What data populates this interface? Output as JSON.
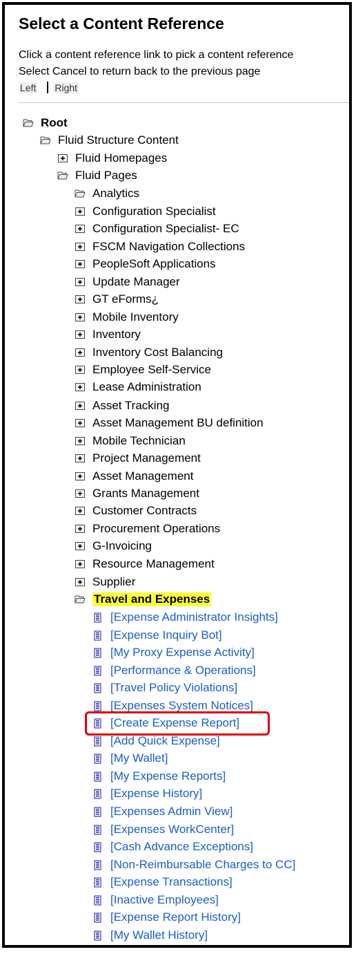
{
  "page": {
    "title": "Select a Content Reference",
    "instruction_1": "Click a content reference link to pick a content reference",
    "instruction_2": "Select Cancel to return back to the previous page",
    "left_label": "Left",
    "right_label": "Right"
  },
  "tree": [
    {
      "label": "Root",
      "level": 0,
      "icon": "folder-open-icon",
      "style": "bold"
    },
    {
      "label": "Fluid Structure Content",
      "level": 1,
      "icon": "folder-open-icon"
    },
    {
      "label": "Fluid Homepages",
      "level": 2,
      "icon": "folder-expand-icon"
    },
    {
      "label": "Fluid Pages",
      "level": 2,
      "icon": "folder-open-icon"
    },
    {
      "label": "Analytics",
      "level": 3,
      "icon": "folder-open-icon"
    },
    {
      "label": "Configuration Specialist",
      "level": 3,
      "icon": "folder-expand-icon"
    },
    {
      "label": "Configuration Specialist- EC",
      "level": 3,
      "icon": "folder-expand-icon"
    },
    {
      "label": "FSCM Navigation Collections",
      "level": 3,
      "icon": "folder-expand-icon"
    },
    {
      "label": "PeopleSoft Applications",
      "level": 3,
      "icon": "folder-expand-icon"
    },
    {
      "label": "Update Manager",
      "level": 3,
      "icon": "folder-expand-icon"
    },
    {
      "label": "GT eForms¿",
      "level": 3,
      "icon": "folder-expand-icon"
    },
    {
      "label": "Mobile Inventory",
      "level": 3,
      "icon": "folder-expand-icon"
    },
    {
      "label": "Inventory",
      "level": 3,
      "icon": "folder-expand-icon"
    },
    {
      "label": "Inventory Cost Balancing",
      "level": 3,
      "icon": "folder-expand-icon"
    },
    {
      "label": "Employee Self-Service",
      "level": 3,
      "icon": "folder-expand-icon"
    },
    {
      "label": "Lease Administration",
      "level": 3,
      "icon": "folder-expand-icon"
    },
    {
      "label": "Asset Tracking",
      "level": 3,
      "icon": "folder-expand-icon"
    },
    {
      "label": "Asset Management BU definition",
      "level": 3,
      "icon": "folder-expand-icon"
    },
    {
      "label": "Mobile Technician",
      "level": 3,
      "icon": "folder-expand-icon"
    },
    {
      "label": "Project Management",
      "level": 3,
      "icon": "folder-expand-icon"
    },
    {
      "label": "Asset Management",
      "level": 3,
      "icon": "folder-expand-icon"
    },
    {
      "label": "Grants Management",
      "level": 3,
      "icon": "folder-expand-icon"
    },
    {
      "label": "Customer Contracts",
      "level": 3,
      "icon": "folder-expand-icon"
    },
    {
      "label": "Procurement Operations",
      "level": 3,
      "icon": "folder-expand-icon"
    },
    {
      "label": "G-Invoicing",
      "level": 3,
      "icon": "folder-expand-icon"
    },
    {
      "label": "Resource Management",
      "level": 3,
      "icon": "folder-expand-icon"
    },
    {
      "label": "Supplier",
      "level": 3,
      "icon": "folder-expand-icon"
    },
    {
      "label": "Travel and Expenses",
      "level": 3,
      "icon": "folder-open-icon",
      "style": "highlight"
    },
    {
      "label": "[Expense Administrator Insights]",
      "level": 4,
      "icon": "document-icon",
      "style": "link"
    },
    {
      "label": "[Expense Inquiry Bot]",
      "level": 4,
      "icon": "document-icon",
      "style": "link"
    },
    {
      "label": "[My Proxy Expense Activity]",
      "level": 4,
      "icon": "document-icon",
      "style": "link"
    },
    {
      "label": "[Performance & Operations]",
      "level": 4,
      "icon": "document-icon",
      "style": "link"
    },
    {
      "label": "[Travel Policy Violations]",
      "level": 4,
      "icon": "document-icon",
      "style": "link"
    },
    {
      "label": "[Expenses System Notices]",
      "level": 4,
      "icon": "document-icon",
      "style": "link"
    },
    {
      "label": "[Create Expense Report]",
      "level": 4,
      "icon": "document-icon",
      "style": "link"
    },
    {
      "label": "[Add Quick Expense]",
      "level": 4,
      "icon": "document-icon",
      "style": "link"
    },
    {
      "label": "[My Wallet]",
      "level": 4,
      "icon": "document-icon",
      "style": "link"
    },
    {
      "label": "[My Expense Reports]",
      "level": 4,
      "icon": "document-icon",
      "style": "link"
    },
    {
      "label": "[Expense History]",
      "level": 4,
      "icon": "document-icon",
      "style": "link"
    },
    {
      "label": "[Expenses Admin View]",
      "level": 4,
      "icon": "document-icon",
      "style": "link"
    },
    {
      "label": "[Expenses WorkCenter]",
      "level": 4,
      "icon": "document-icon",
      "style": "link"
    },
    {
      "label": "[Cash Advance Exceptions]",
      "level": 4,
      "icon": "document-icon",
      "style": "link"
    },
    {
      "label": "[Non-Reimbursable Charges to CC]",
      "level": 4,
      "icon": "document-icon",
      "style": "link"
    },
    {
      "label": "[Expense Transactions]",
      "level": 4,
      "icon": "document-icon",
      "style": "link"
    },
    {
      "label": "[Inactive Employees]",
      "level": 4,
      "icon": "document-icon",
      "style": "link"
    },
    {
      "label": "[Expense Report History]",
      "level": 4,
      "icon": "document-icon",
      "style": "link"
    },
    {
      "label": "[My Wallet History]",
      "level": 4,
      "icon": "document-icon",
      "style": "link"
    }
  ],
  "colors": {
    "link": "#1a5fc9",
    "highlight": "#ffff33",
    "annotation": "#e00000"
  }
}
